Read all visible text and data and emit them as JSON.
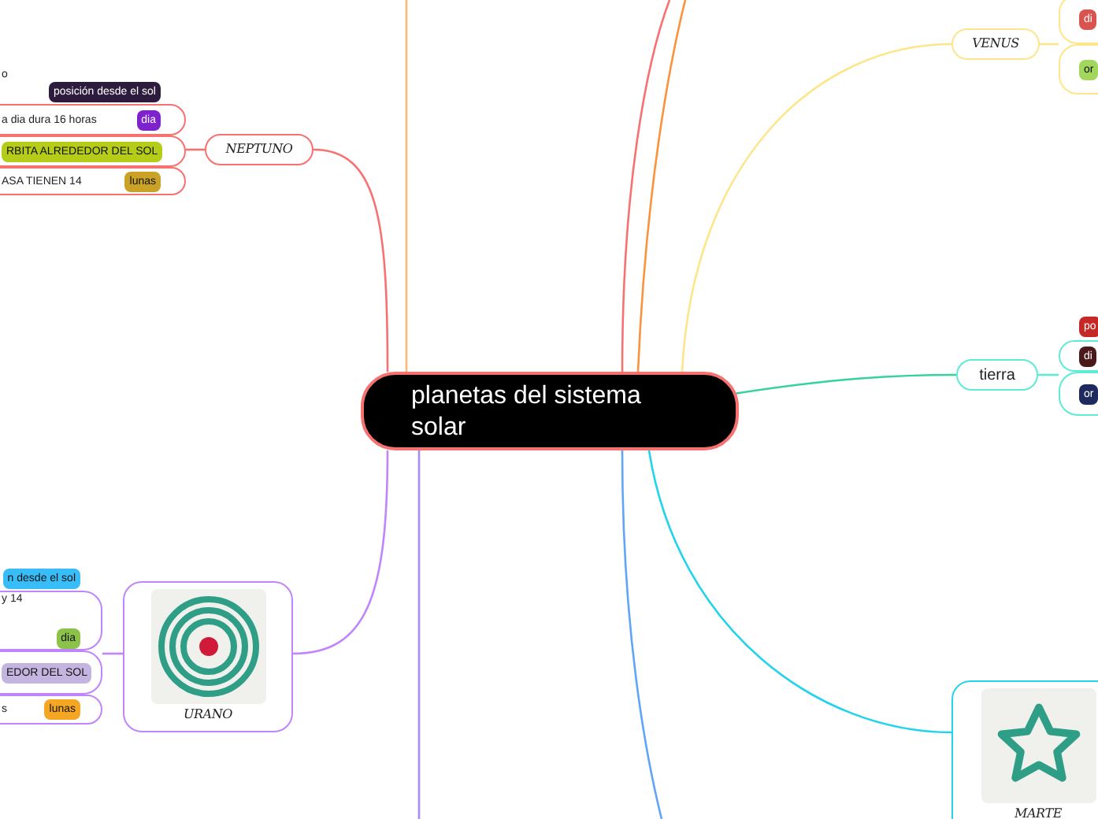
{
  "central_topic": "planetas del sistema solar",
  "branches": [
    {
      "kind": "text",
      "label": "NEPTUNO",
      "rows": [
        {
          "text": "o",
          "tag": {
            "label": "posición desde el sol",
            "color": "#2d1b3d"
          }
        },
        {
          "text": "a dia dura 16 horas",
          "tag": {
            "label": "dia",
            "color": "#7e22ce"
          }
        },
        {
          "tag": {
            "label": "RBITA ALREDEDOR DEL SOL",
            "color": "#b5cc18"
          }
        },
        {
          "text": "ASA TIENEN 14",
          "tag": {
            "label": "lunas",
            "color": "#c9a227"
          }
        }
      ]
    },
    {
      "kind": "image",
      "label": "URANO",
      "rows": [
        {
          "tag": {
            "label": "n desde el sol",
            "color": "#38bdf8"
          }
        },
        {
          "text": "y 14",
          "tag": {
            "label": "dia",
            "color": "#8bc34a"
          }
        },
        {
          "tag": {
            "label": "EDOR DEL SOL",
            "color": "#c4b5e0"
          }
        },
        {
          "text": "s",
          "tag": {
            "label": "lunas",
            "color": "#f5a623"
          }
        }
      ]
    },
    {
      "kind": "text",
      "label": "VENUS",
      "rows": [
        {
          "tag": {
            "label": "di",
            "color": "#d9534f"
          }
        },
        {
          "tag": {
            "label": "or",
            "color": "#a3d65c"
          }
        }
      ]
    },
    {
      "kind": "text",
      "label": "tierra",
      "rows": [
        {
          "tag": {
            "label": "po",
            "color": "#c62828"
          }
        },
        {
          "tag": {
            "label": "di",
            "color": "#4a1a1a"
          }
        },
        {
          "tag": {
            "label": "or",
            "color": "#1e2a5e"
          }
        }
      ]
    },
    {
      "kind": "image",
      "label": "MARTE"
    }
  ]
}
